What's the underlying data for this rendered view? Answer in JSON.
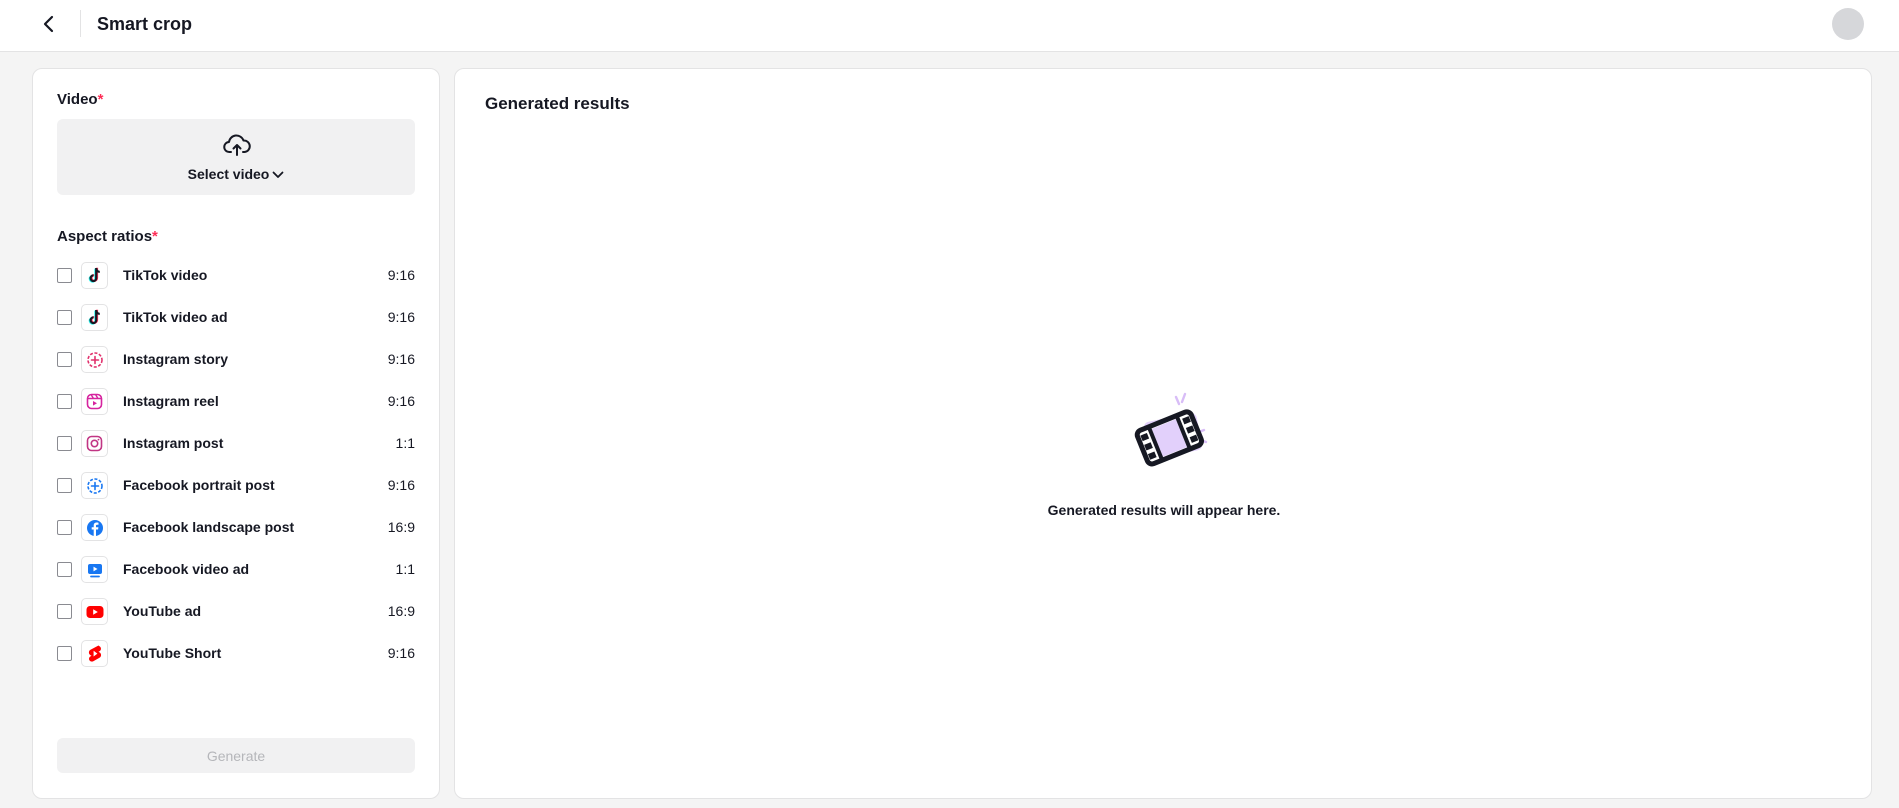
{
  "header": {
    "title": "Smart crop"
  },
  "left": {
    "video_label": "Video",
    "required_mark": "*",
    "select_video_label": "Select video",
    "aspect_label": "Aspect ratios",
    "generate_label": "Generate",
    "items": [
      {
        "name": "TikTok video",
        "ratio": "9:16",
        "icon": "tiktok-icon"
      },
      {
        "name": "TikTok video ad",
        "ratio": "9:16",
        "icon": "tiktok-icon"
      },
      {
        "name": "Instagram story",
        "ratio": "9:16",
        "icon": "instagram-story-icon"
      },
      {
        "name": "Instagram reel",
        "ratio": "9:16",
        "icon": "instagram-reel-icon"
      },
      {
        "name": "Instagram post",
        "ratio": "1:1",
        "icon": "instagram-icon"
      },
      {
        "name": "Facebook portrait post",
        "ratio": "9:16",
        "icon": "facebook-story-icon"
      },
      {
        "name": "Facebook landscape post",
        "ratio": "16:9",
        "icon": "facebook-icon"
      },
      {
        "name": "Facebook video ad",
        "ratio": "1:1",
        "icon": "facebook-video-icon"
      },
      {
        "name": "YouTube ad",
        "ratio": "16:9",
        "icon": "youtube-icon"
      },
      {
        "name": "YouTube Short",
        "ratio": "9:16",
        "icon": "youtube-shorts-icon"
      }
    ]
  },
  "right": {
    "title": "Generated results",
    "empty_text": "Generated results will appear here."
  },
  "colors": {
    "required": "#fe2c55",
    "accent_purple": "#e2d0fb",
    "facebook_blue": "#1877f2",
    "youtube_red": "#ff0000"
  }
}
